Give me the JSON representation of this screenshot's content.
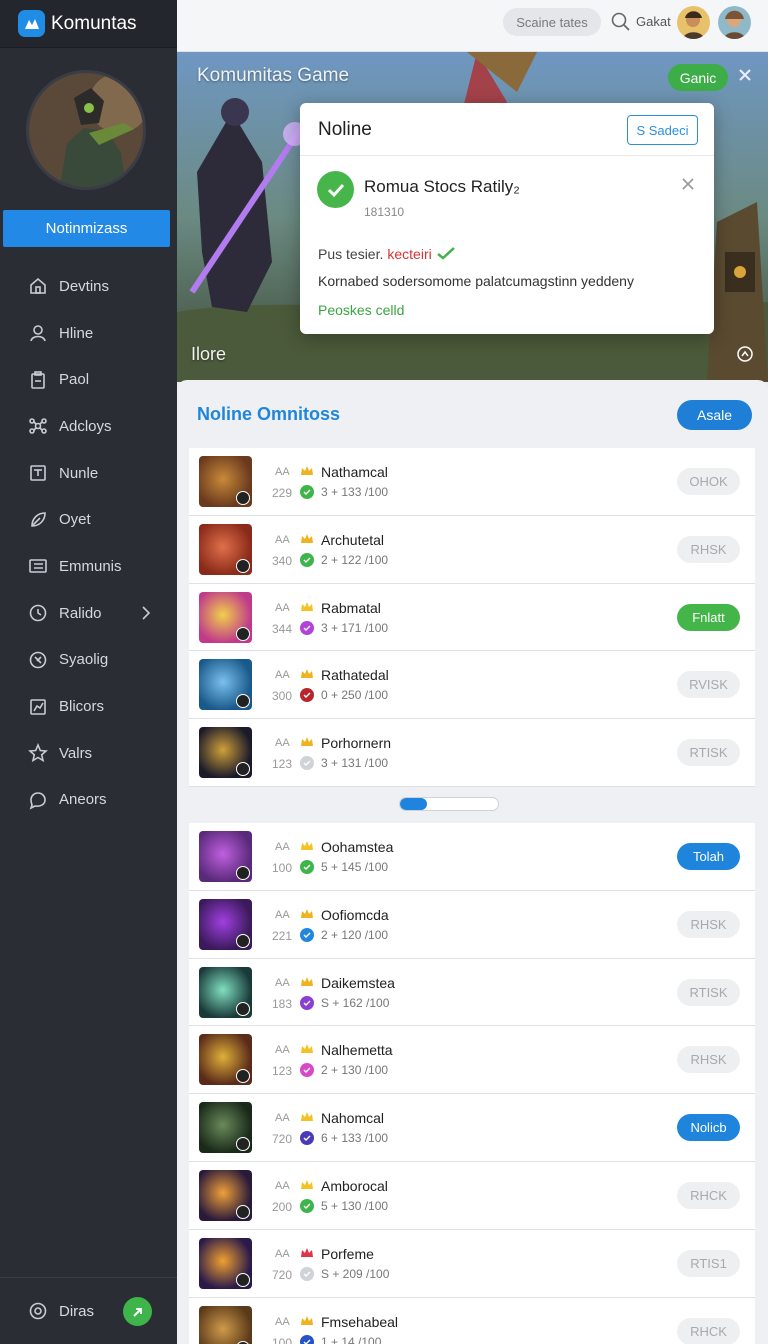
{
  "brand": {
    "name": "Komuntas"
  },
  "sidebar": {
    "primary_button": "Notinmizass",
    "items": [
      {
        "label": "Devtins",
        "icon": "home-icon"
      },
      {
        "label": "Hline",
        "icon": "user-icon"
      },
      {
        "label": "Paol",
        "icon": "clipboard-icon"
      },
      {
        "label": "Adcloys",
        "icon": "network-icon"
      },
      {
        "label": "Nunle",
        "icon": "box-icon"
      },
      {
        "label": "Oyet",
        "icon": "leaf-icon"
      },
      {
        "label": "Emmunis",
        "icon": "list-icon"
      },
      {
        "label": "Ralido",
        "icon": "compass-icon"
      },
      {
        "label": "Syaolig",
        "icon": "target-icon"
      },
      {
        "label": "Blicors",
        "icon": "chart-icon"
      },
      {
        "label": "Valrs",
        "icon": "star-icon"
      },
      {
        "label": "Aneors",
        "icon": "chat-icon"
      }
    ],
    "footer": {
      "label": "Diras"
    }
  },
  "topbar": {
    "search_placeholder": "Scaine tates",
    "link": "Gakat"
  },
  "hero": {
    "title": "Komumitas Game",
    "subtitle": "Ilore",
    "game_button": "Ganic"
  },
  "modal": {
    "title": "Noline",
    "select": "S Sadeci",
    "notice_title": "Romua Stocs Ratily₂",
    "notice_sub": "181310",
    "pus_label": "Pus tesier.",
    "pus_red": "kecteiri",
    "body": "Kornabed sodersomome palatcumagstinn yeddeny",
    "link": "Peoskes celld"
  },
  "panel": {
    "title": "Noline Omnitoss",
    "button": "Asale",
    "scroll_progress": 0.28,
    "rows": [
      {
        "name": "Nathamcal",
        "tag": "AA",
        "num": "229",
        "stats": "3 +  133 /100",
        "button": "OHOK",
        "style": "gray",
        "dot": "#3eb54a",
        "crown": "#f0b21e"
      },
      {
        "name": "Archutetal",
        "tag": "AA",
        "num": "340",
        "stats": "2 +  122 /100",
        "button": "RHSK",
        "style": "gray",
        "dot": "#3eb54a",
        "crown": "#f0b21e"
      },
      {
        "name": "Rabmatal",
        "tag": "AA",
        "num": "344",
        "stats": "3 +  171 /100",
        "button": "Fnlatt",
        "style": "green",
        "dot": "#b143d8",
        "crown": "#f3c326"
      },
      {
        "name": "Rathatedal",
        "tag": "AA",
        "num": "300",
        "stats": "0 +  250 /100",
        "button": "RVISK",
        "style": "gray",
        "dot": "#b8262c",
        "crown": "#f0b21e"
      },
      {
        "name": "Porhornern",
        "tag": "AA",
        "num": "123",
        "stats": "3 +  131 /100",
        "button": "RTISK",
        "style": "gray",
        "dot": "#cfd2d6",
        "crown": "#f0b21e"
      },
      {
        "name": "Oohamstea",
        "tag": "AA",
        "num": "100",
        "stats": "5 +  145 /100",
        "button": "Tolah",
        "style": "blue",
        "dot": "#3eb54a",
        "crown": "#f3c326"
      },
      {
        "name": "Oofiomcda",
        "tag": "AA",
        "num": "221",
        "stats": "2 +  120 /100",
        "button": "RHSK",
        "style": "gray",
        "dot": "#2187dc",
        "crown": "#f0b21e"
      },
      {
        "name": "Daikemstea",
        "tag": "AA",
        "num": "183",
        "stats": "S +  162 /100",
        "button": "RTISK",
        "style": "gray",
        "dot": "#8a3fd0",
        "crown": "#f0b21e"
      },
      {
        "name": "Nalhemetta",
        "tag": "AA",
        "num": "123",
        "stats": "2 +  130 /100",
        "button": "RHSK",
        "style": "gray",
        "dot": "#d64ac6",
        "crown": "#f3c326"
      },
      {
        "name": "Nahomcal",
        "tag": "AA",
        "num": "720",
        "stats": "6 +  133 /100",
        "button": "Nolicb",
        "style": "blue",
        "dot": "#4a3ab8",
        "crown": "#f3c326"
      },
      {
        "name": "Amborocal",
        "tag": "AA",
        "num": "200",
        "stats": "5 +  130 /100",
        "button": "RHCK",
        "style": "gray",
        "dot": "#3eb54a",
        "crown": "#f3c326"
      },
      {
        "name": "Porfeme",
        "tag": "AA",
        "num": "720",
        "stats": "S +  209 /100",
        "button": "RTIS1",
        "style": "gray",
        "dot": "#cfd2d6",
        "crown": "#e0344a"
      },
      {
        "name": "Fmsehabeal",
        "tag": "AA",
        "num": "100",
        "stats": "1 +  14 /100",
        "button": "RHCK",
        "style": "gray",
        "dot": "#2453c8",
        "crown": "#f0b21e"
      }
    ]
  }
}
